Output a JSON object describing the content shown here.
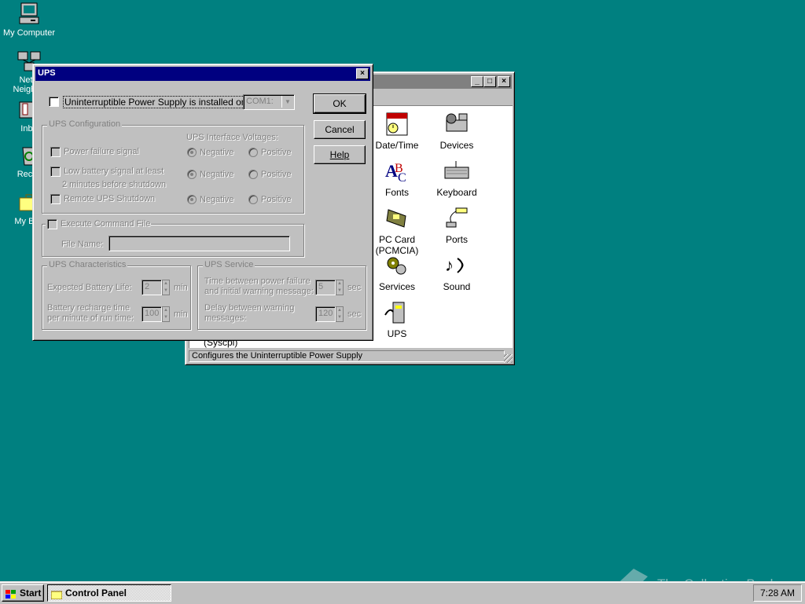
{
  "desktop": {
    "icons": [
      {
        "label": "My Computer",
        "icon": "my-computer-icon"
      },
      {
        "label": "Netw",
        "label2": "Neighbo",
        "icon": "network-neighborhood-icon"
      },
      {
        "label": "Inbo",
        "icon": "inbox-icon"
      },
      {
        "label": "Recyc",
        "icon": "recycle-bin-icon"
      },
      {
        "label": "My Brie",
        "icon": "my-briefcase-icon"
      }
    ]
  },
  "control_panel": {
    "status_text": "Configures the Uninterruptible Power Supply",
    "partial_label": "(Syscpl)",
    "items": [
      {
        "label": "Date/Time",
        "icon": "date-time-icon"
      },
      {
        "label": "Devices",
        "icon": "devices-icon"
      },
      {
        "label": "Fonts",
        "icon": "fonts-icon"
      },
      {
        "label": "Keyboard",
        "icon": "keyboard-icon"
      },
      {
        "label": "PC Card",
        "label2": "(PCMCIA)",
        "icon": "pc-card-icon"
      },
      {
        "label": "Ports",
        "icon": "ports-icon"
      },
      {
        "label": "Services",
        "icon": "services-icon"
      },
      {
        "label": "Sound",
        "icon": "sound-icon"
      },
      {
        "label": "UPS",
        "icon": "ups-icon"
      }
    ]
  },
  "ups_dialog": {
    "title": "UPS",
    "installed_label": "Uninterruptible Power Supply is installed on:",
    "port_value": "COM1:",
    "ok": "OK",
    "cancel": "Cancel",
    "help": "Help",
    "config_group": "UPS Configuration",
    "voltages_label": "UPS Interface Voltages:",
    "power_failure": "Power failure signal",
    "low_battery": "Low battery signal at least",
    "low_battery2": "2 minutes before shutdown",
    "remote_shutdown": "Remote UPS Shutdown",
    "negative": "Negative",
    "positive": "Positive",
    "execute_group": "Execute Command File",
    "file_name_label": "File Name:",
    "characteristics_group": "UPS Characteristics",
    "expected_life": "Expected  Battery Life:",
    "expected_life_value": "2",
    "recharge_time": "Battery recharge time",
    "recharge_time2": "per minute of run time:",
    "recharge_value": "100",
    "min": "min",
    "service_group": "UPS Service",
    "time_between": "Time between power failure",
    "time_between2": "and initial warning message:",
    "time_between_value": "5",
    "delay_between": "Delay between warning",
    "delay_between2": "messages:",
    "delay_value": "120",
    "sec": "sec"
  },
  "taskbar": {
    "start": "Start",
    "task": "Control Panel",
    "clock": "7:28 AM"
  },
  "watermark": "The Collection Book"
}
